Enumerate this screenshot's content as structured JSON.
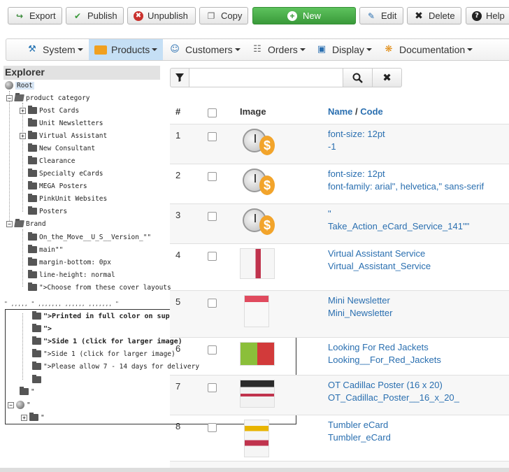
{
  "toolbar": {
    "export": "Export",
    "publish": "Publish",
    "unpublish": "Unpublish",
    "copy": "Copy",
    "new": "New",
    "edit": "Edit",
    "delete": "Delete",
    "help": "Help"
  },
  "menu": {
    "system": "System",
    "products": "Products",
    "customers": "Customers",
    "orders": "Orders",
    "display": "Display",
    "documentation": "Documentation"
  },
  "explorer": {
    "title": "Explorer",
    "root": "Root",
    "product_category": "product category",
    "categories": [
      "Post Cards",
      "Unit Newsletters",
      "Virtual Assistant",
      "New Consultant",
      "Clearance",
      "Specialty eCards",
      "MEGA Posters",
      "PinkUnit Websites",
      "Posters"
    ],
    "brand": "Brand",
    "brand_items": [
      "On_the_Move__U_S__Version_\"\"",
      "main\"\"",
      "margin-bottom: 0px",
      "line-height: normal",
      "\">Choose from these cover layouts"
    ],
    "scrap1": "\" ,,,,, \" ,,,,,,, ,,,,,, ,,,,,,, \"",
    "box_items": [
      "\">Printed in full color on super smoot",
      "\">",
      "\">Side 1 (click for larger image)",
      "\">Side 1 (click for larger image)",
      "\">Please allow 7 - 14 days for delivery"
    ],
    "quote": "\"",
    "globe_quote": "\"",
    "last_quote": "\""
  },
  "search": {
    "placeholder": ""
  },
  "table": {
    "headers": {
      "num": "#",
      "image": "Image",
      "name": "Name",
      "sep": " / ",
      "code": "Code"
    },
    "rows": [
      {
        "num": "1",
        "name": "font-size: 12pt",
        "code": "-1"
      },
      {
        "num": "2",
        "name": "font-size: 12pt",
        "code": "font-family: arial\", helvetica,\" sans-serif"
      },
      {
        "num": "3",
        "name": "\"",
        "code": "Take_Action_eCard_Service_141\"\""
      },
      {
        "num": "4",
        "name": "Virtual Assistant Service",
        "code": "Virtual_Assistant_Service"
      },
      {
        "num": "5",
        "name": "Mini Newsletter",
        "code": "Mini_Newsletter"
      },
      {
        "num": "6",
        "name": "Looking For Red Jackets",
        "code": "Looking__For_Red_Jackets"
      },
      {
        "num": "7",
        "name": "OT Cadillac Poster (16 x 20)",
        "code": "OT_Cadillac_Poster__16_x_20_"
      },
      {
        "num": "8",
        "name": "Tumbler eCard",
        "code": "Tumbler_eCard"
      }
    ]
  }
}
